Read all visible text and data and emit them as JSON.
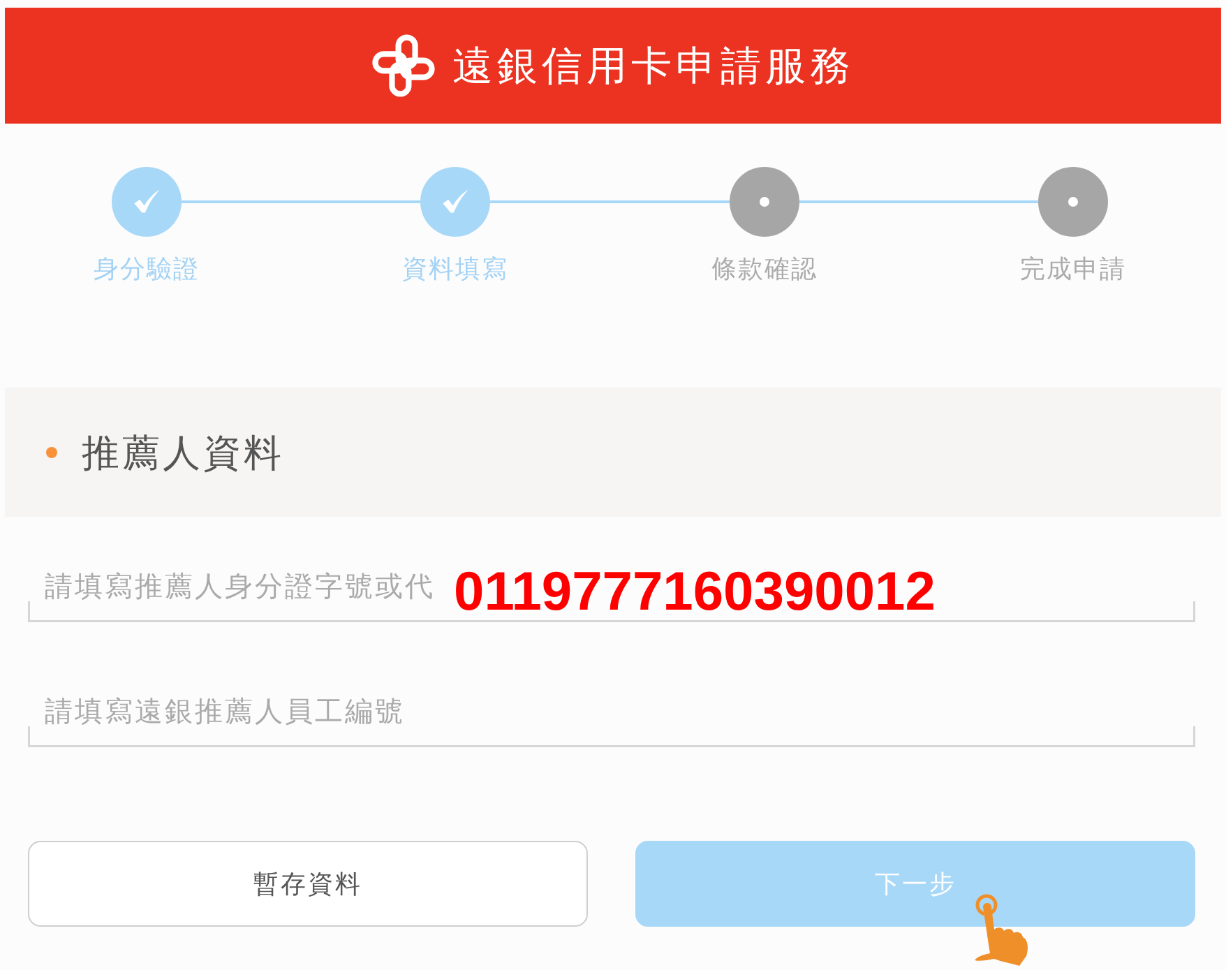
{
  "header": {
    "title": "遠銀信用卡申請服務"
  },
  "steps": [
    {
      "label": "身分驗證",
      "completed": true
    },
    {
      "label": "資料填寫",
      "completed": true
    },
    {
      "label": "條款確認",
      "completed": false
    },
    {
      "label": "完成申請",
      "completed": false
    }
  ],
  "section": {
    "title": "推薦人資料"
  },
  "fields": [
    {
      "placeholder": "請填寫推薦人身分證字號或代",
      "annotation": "0119777160390012"
    },
    {
      "placeholder": "請填寫遠銀推薦人員工編號"
    }
  ],
  "buttons": [
    {
      "label": "暫存資料",
      "kind": "secondary"
    },
    {
      "label": "下一步",
      "kind": "primary"
    }
  ]
}
